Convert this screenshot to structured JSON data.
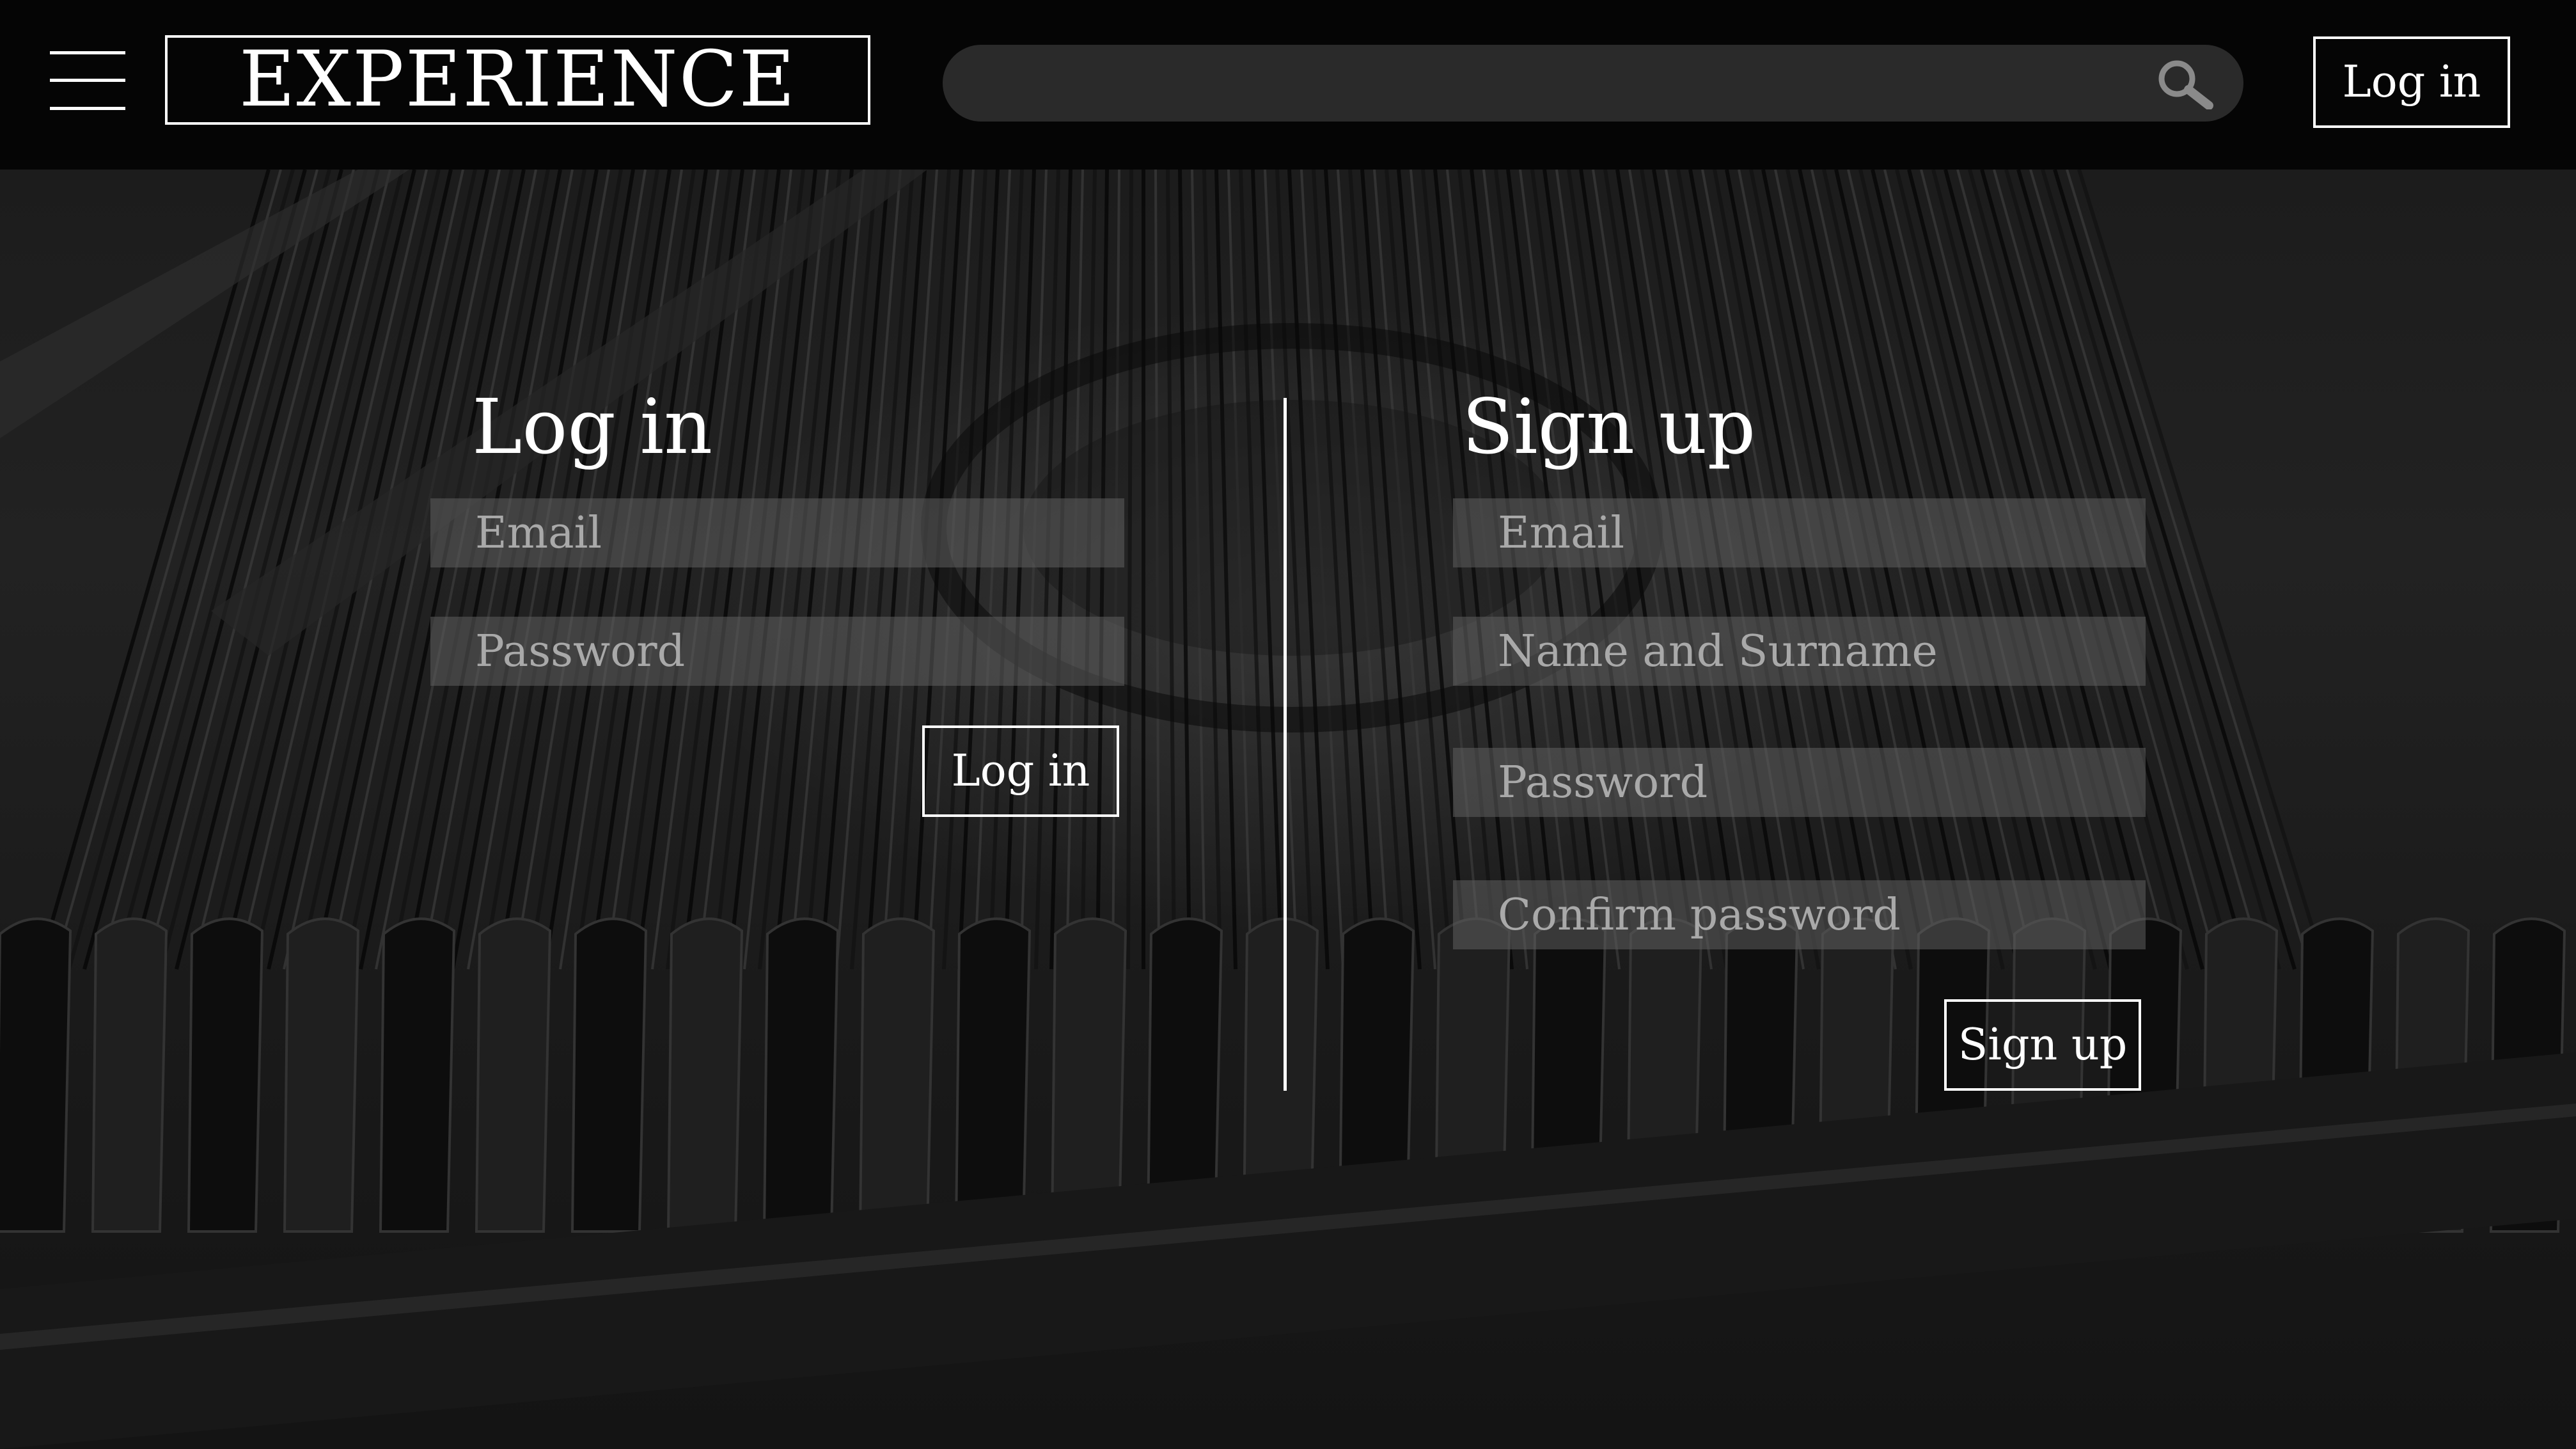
{
  "header": {
    "menu_icon": "hamburger-icon",
    "logo": "EXPERIENCE",
    "search": {
      "placeholder": "",
      "value": "",
      "icon": "search-icon"
    },
    "login_label": "Log in"
  },
  "login": {
    "title": "Log in",
    "email_placeholder": "Email",
    "password_placeholder": "Password",
    "submit_label": "Log in"
  },
  "signup": {
    "title": "Sign up",
    "email_placeholder": "Email",
    "name_placeholder": "Name and Surname",
    "password_placeholder": "Password",
    "confirm_placeholder": "Confirm password",
    "submit_label": "Sign up"
  },
  "colors": {
    "header_bg": "#050505",
    "page_bg": "#1b1b1b",
    "field_bg": "#5f5f5f",
    "search_bg": "#2a2a2a",
    "text": "#ffffff",
    "placeholder": "#a9a9a9"
  }
}
